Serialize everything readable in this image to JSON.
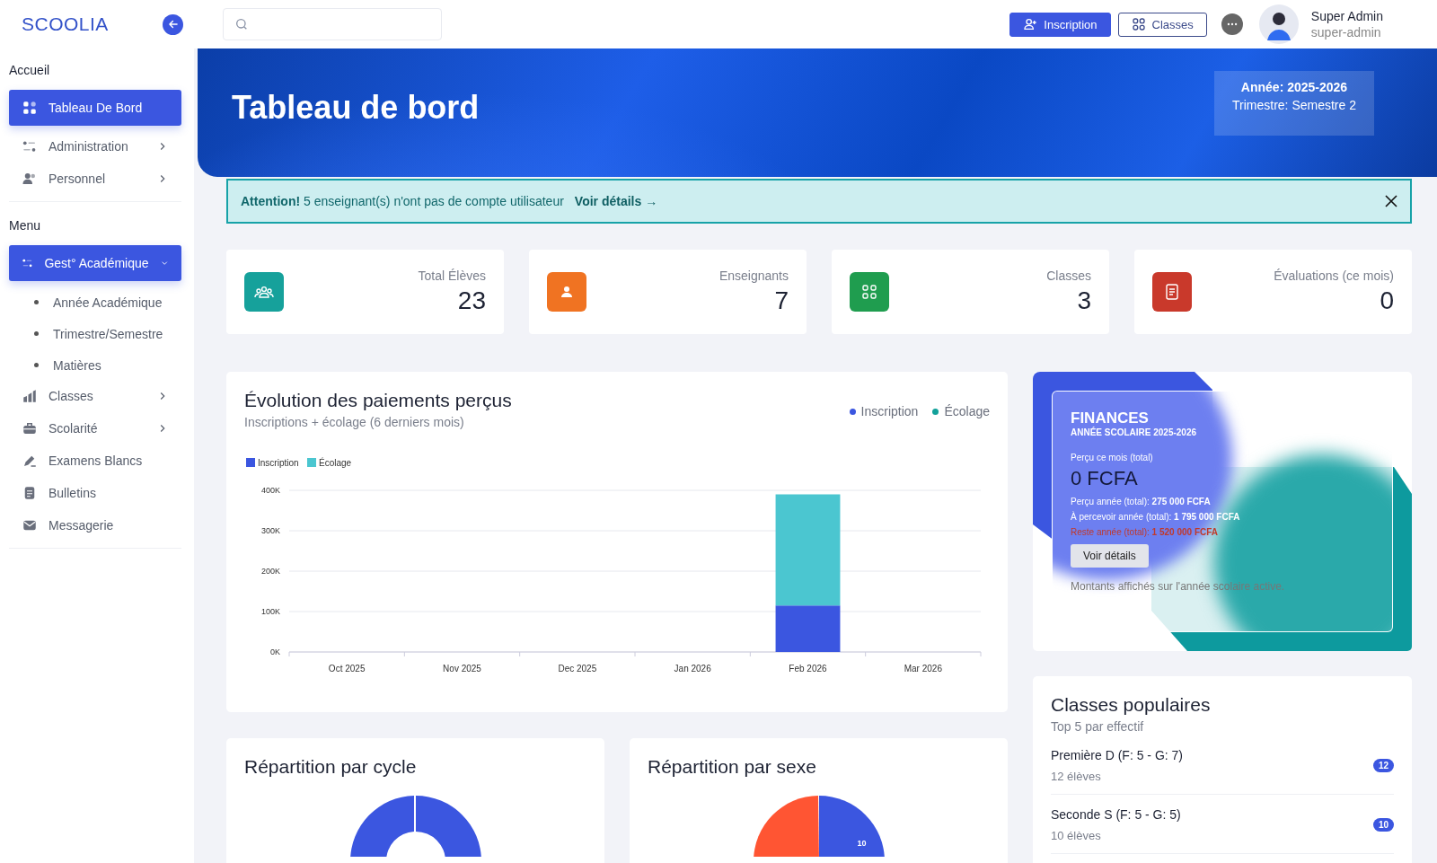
{
  "topbar": {
    "logo": "SCOOLIA",
    "buttons": [
      {
        "label": "Inscription",
        "kind": "primary"
      },
      {
        "label": "Classes",
        "kind": "outline"
      }
    ],
    "user": {
      "name": "Super Admin",
      "role": "super-admin"
    }
  },
  "sidebar": {
    "sections": [
      {
        "title": "Accueil",
        "items": [
          {
            "label": "Tableau De Bord",
            "selected": true
          },
          {
            "label": "Administration",
            "selected": false,
            "expanded": false
          },
          {
            "label": "Personnel",
            "selected": false,
            "expanded": false
          }
        ]
      },
      {
        "title": "Menu",
        "items": [
          {
            "label": "Gest° Académique",
            "selected": true,
            "expanded": true,
            "children": [
              {
                "label": "Année Académique"
              },
              {
                "label": "Trimestre/Semestre"
              },
              {
                "label": "Matières"
              }
            ]
          },
          {
            "label": "Classes",
            "selected": false,
            "expanded": false
          },
          {
            "label": "Scolarité",
            "selected": false,
            "expanded": false
          },
          {
            "label": "Examens Blancs",
            "selected": false
          },
          {
            "label": "Bulletins",
            "selected": false
          },
          {
            "label": "Messagerie",
            "selected": false
          }
        ]
      }
    ]
  },
  "banner": {
    "title": "Tableau de bord",
    "year": "Année: 2025-2026",
    "term": "Trimestre: Semestre 2"
  },
  "alert": {
    "message": "**Attention!** 5 enseignant(s) n'ont pas de compte utilisateur",
    "link": "Voir détails →"
  },
  "stats": [
    {
      "label": "Total Élèves",
      "value": "23",
      "color": "#16a19b"
    },
    {
      "label": "Enseignants",
      "value": "7",
      "color": "#f07322"
    },
    {
      "label": "Classes",
      "value": "3",
      "color": "#1f9d4f"
    },
    {
      "label": "Évaluations (ce mois)",
      "value": "0",
      "color": "#c9392b"
    }
  ],
  "payments": {
    "title": "Évolution des paiements perçus",
    "subtitle": "Inscriptions + écolage (6 derniers mois)",
    "legend": [
      {
        "label": "Inscription",
        "color": "#3b56e0"
      },
      {
        "label": "Écolage",
        "color": "#12a19a"
      }
    ],
    "chart_data": {
      "type": "bar",
      "stacked": true,
      "categories": [
        "Oct 2025",
        "Nov 2025",
        "Dec 2025",
        "Jan 2026",
        "Feb 2026",
        "Mar 2026"
      ],
      "series": [
        {
          "name": "Inscription",
          "color": "#3b56e0",
          "values": [
            0,
            0,
            0,
            0,
            115000,
            0
          ]
        },
        {
          "name": "Écolage",
          "color": "#4bc6d0",
          "values": [
            0,
            0,
            0,
            0,
            275000,
            0
          ]
        }
      ],
      "grid": true,
      "legend": true,
      "ylim": [
        0,
        400000
      ],
      "yticks": [
        {
          "value": 0,
          "label": "0K"
        },
        {
          "value": 100000,
          "label": "100K"
        },
        {
          "value": 200000,
          "label": "200K"
        },
        {
          "value": 300000,
          "label": "300K"
        },
        {
          "value": 400000,
          "label": "400K"
        }
      ]
    }
  },
  "finances": {
    "title": "FINANCES",
    "subtitle": "ANNÉE SCOLAIRE 2025-2026",
    "month_label": "Perçu ce mois (total)",
    "month_value": "0 FCFA",
    "lines": [
      {
        "text": "Perçu année (total): **275 000 FCFA**",
        "kind": "normal"
      },
      {
        "text": "À percevoir année (total): **1 795 000 FCFA**",
        "kind": "normal"
      },
      {
        "text": "Reste année (total): **1 520 000 FCFA**",
        "kind": "alert"
      }
    ],
    "button": "Voir détails",
    "note": "Montants affichés sur l'année scolaire active."
  },
  "popular": {
    "title": "Classes populaires",
    "subtitle": "Top 5 par effectif",
    "items": [
      {
        "name": "Première D (F: 5 - G: 7)",
        "count": "12 élèves",
        "badge": "12"
      },
      {
        "name": "Seconde S (F: 5 - G: 5)",
        "count": "10 élèves",
        "badge": "10"
      }
    ]
  },
  "cycle": {
    "title": "Répartition par cycle"
  },
  "gender": {
    "title": "Répartition par sexe",
    "slice_label": "10"
  }
}
